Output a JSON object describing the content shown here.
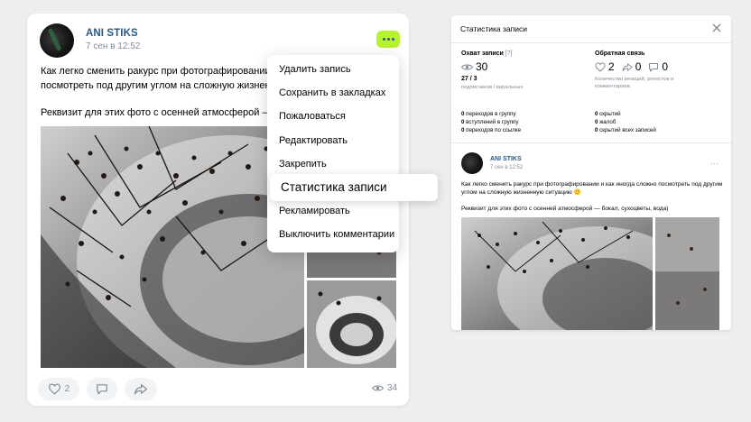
{
  "post": {
    "author": "ANI STIKS",
    "date": "7 сен в 12:52",
    "text": "Как легко сменить ракурс при фотографировании и к",
    "text_cont": "посмотреть под другим углом на сложную жизненну",
    "text2": "Реквизит для этих фото с осенней атмосферой — бок",
    "likes": "2",
    "views": "34"
  },
  "menu": {
    "items": [
      "Удалить запись",
      "Сохранить в закладках",
      "Пожаловаться",
      "Редактировать",
      "Закрепить",
      "Статистика записи",
      "Рекламировать",
      "Выключить комментарии"
    ]
  },
  "stats": {
    "title": "Статистика записи",
    "reach_title": "Охват записи",
    "reach_help": "[?]",
    "reach_value": "30",
    "subscribers_viral": "27 / 3",
    "subscribers_viral_label": "подписчиков / виральных",
    "feedback_title": "Обратная связь",
    "likes": "2",
    "reposts": "0",
    "comments": "0",
    "feedback_desc": "Количество реакций, репостов и комментариев.",
    "left_lines": [
      {
        "n": "0",
        "t": " переходов в группу"
      },
      {
        "n": "0",
        "t": " вступлений в группу"
      },
      {
        "n": "0",
        "t": " переходов по ссылке"
      }
    ],
    "right_lines": [
      {
        "n": "0",
        "t": " скрытий"
      },
      {
        "n": "0",
        "t": " жалоб"
      },
      {
        "n": "0",
        "t": " скрытий всех записей"
      }
    ],
    "post_author": "ANI STIKS",
    "post_date": "7 сен в 12:52",
    "post_more": "···",
    "post_text": "Как легко сменить ракурс при фотографировании и как иногда сложно посмотреть под другим углом на сложную жизненную ситуацию 🙂",
    "post_text2": "Реквизит для этих фото с осенней атмосферой — бокал, сухоцветы, вода)"
  },
  "colors": {
    "accent": "#2a5885",
    "more_button": "#b6f22d",
    "background": "#edeef0",
    "muted": "#818c99"
  }
}
